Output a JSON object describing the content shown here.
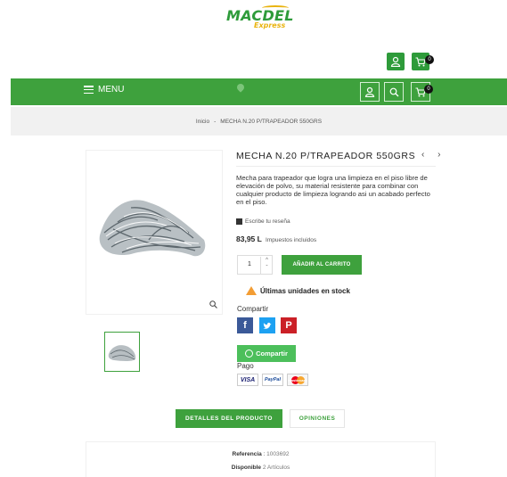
{
  "brand": {
    "name_part1": "MAC",
    "name_part2": "DEL",
    "tagline": "Express"
  },
  "header": {
    "cart_count": "0",
    "menu_label": "MENU"
  },
  "breadcrumb": {
    "home": "Inicio",
    "separator": "-",
    "current": "MECHA N.20 P/TRAPEADOR 550GRS"
  },
  "product": {
    "title": "MECHA N.20 P/TRAPEADOR 550GRS",
    "nav": "‹ ›",
    "description": "Mecha para trapeador que logra una limpieza en el piso libre de elevación de polvo, su material resistente para combinar con cualquier producto de limpieza logrando asi un acabado perfecto en el piso.",
    "review_link": "Escribe tu reseña",
    "price": "83,95 L",
    "tax_note": "Impuestos incluidos",
    "quantity": "1",
    "add_to_cart": "AÑADIR AL CARRITO",
    "stock_notice": "Últimas unidades en stock",
    "share_label": "Compartir",
    "whatsapp_label": "Compartir",
    "payment_label": "Pago",
    "payment_methods": [
      "VISA",
      "PayPal",
      "mastercard"
    ]
  },
  "tabs": [
    {
      "label": "DETALLES DEL PRODUCTO",
      "active": true
    },
    {
      "label": "OPINIONES",
      "active": false
    }
  ],
  "details": {
    "reference_label": "Referencia",
    "reference_value": "1003692",
    "availability_label": "Disponible",
    "availability_value": "2 Artículos"
  },
  "colors": {
    "accent": "#3ea13d",
    "logo_yellow": "#e9b30e",
    "warning": "#f39d34"
  }
}
